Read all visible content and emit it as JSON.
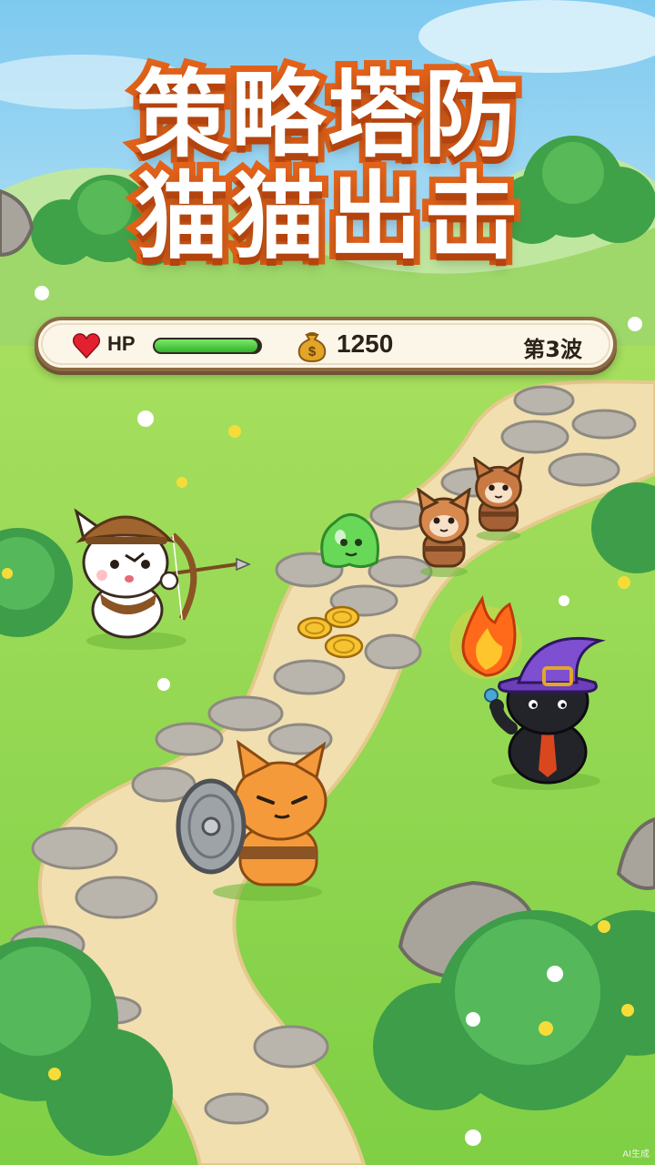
{
  "title": {
    "line1": "策略塔防",
    "line2": "猫猫出击"
  },
  "hud": {
    "hp_label": "HP",
    "hp_fraction": 0.97,
    "gold": "1250",
    "wave": "第3波"
  },
  "colors": {
    "title_outline": "#e2621a",
    "hp_bar": "#31b22a",
    "grass": "#8fd34d",
    "path": "#f1dfb0"
  },
  "icons": [
    "heart-icon",
    "money-bag-icon"
  ],
  "units": [
    "archer-cat",
    "shield-cat",
    "wizard-cat",
    "green-slime",
    "brown-cat-enemy-1",
    "brown-cat-enemy-2",
    "coin-pile"
  ],
  "watermark": "AI生成"
}
